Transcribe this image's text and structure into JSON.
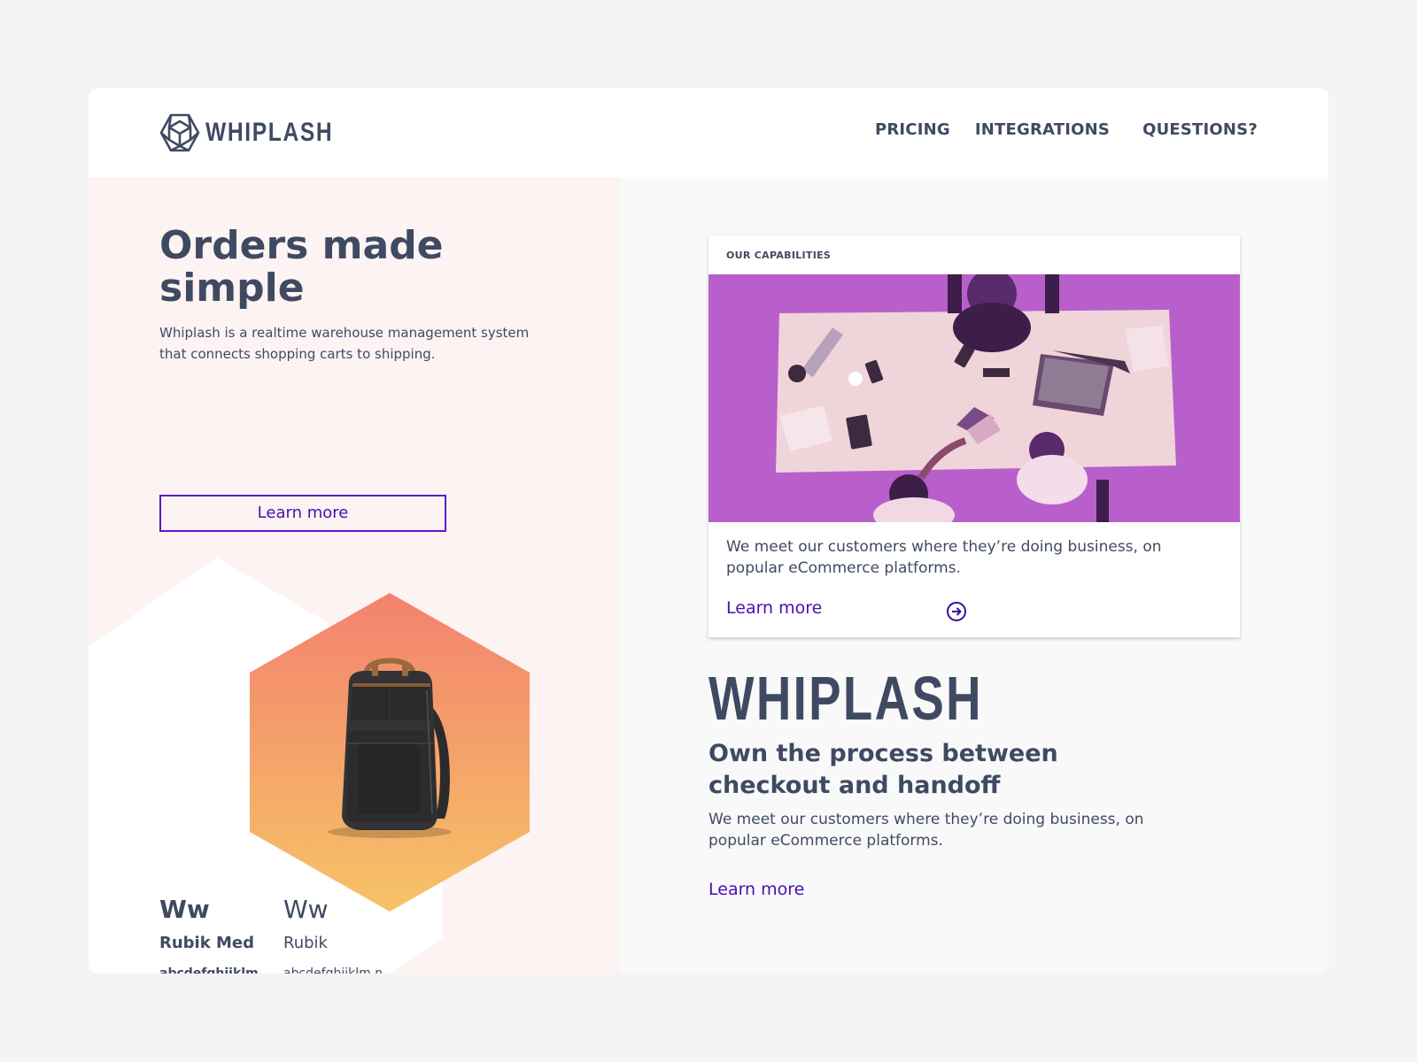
{
  "header": {
    "brand": "WHIPLASH",
    "nav": [
      "PRICING",
      "INTEGRATIONS",
      "QUESTIONS?"
    ]
  },
  "hero": {
    "title": "Orders made simple",
    "subtitle": "Whiplash is a realtime warehouse management system that connects shopping carts to shipping.",
    "button": "Learn more"
  },
  "typography": {
    "medium": {
      "sample": "Ww",
      "name": "Rubik Med",
      "alphabet": "abcdefghijklm nopqrs"
    },
    "regular": {
      "sample": "Ww",
      "name": "Rubik",
      "alphabet": "abcdefghijklm nopqrs"
    }
  },
  "card": {
    "label": "OUR CAPABILITIES",
    "text": "We meet our customers where they’re doing business, on popular eCommerce platforms.",
    "link": "Learn more"
  },
  "brand_section": {
    "wordmark": "WHIPLASH",
    "headline": "Own the process between checkout and handoff",
    "description": "We meet our customers where they’re doing business, on popular eCommerce platforms.",
    "link": "Learn more"
  },
  "colors": {
    "text": "#3f4a62",
    "accent": "#4a0fb0",
    "hero_bg": "#fdf3f3",
    "gradient_top": "#f3826f",
    "gradient_bottom": "#f6c366",
    "photo_tint": "#a23cc8"
  },
  "icons": {
    "logo": "hexagon-cube-icon",
    "card_arrow": "circle-arrow-right-icon"
  }
}
